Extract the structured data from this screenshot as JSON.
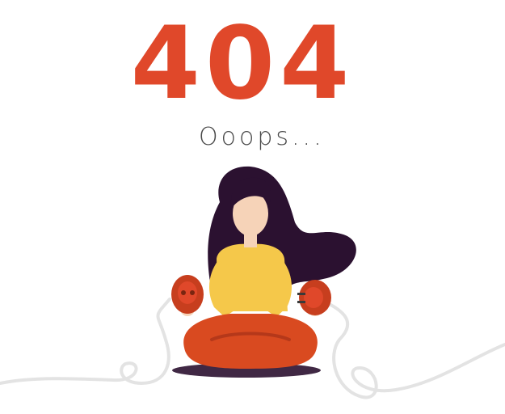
{
  "error": {
    "code": "404",
    "message": "Ooops..."
  },
  "colors": {
    "accent": "#e0482a",
    "hair": "#2b1130",
    "shirt": "#f5c84a",
    "pants": "#d94a20",
    "skin": "#f6d3b8",
    "text": "#4a4a4a",
    "cable": "#e3e3e3"
  },
  "illustration": {
    "icon": "woman-holding-unplugged-cable-icon"
  }
}
